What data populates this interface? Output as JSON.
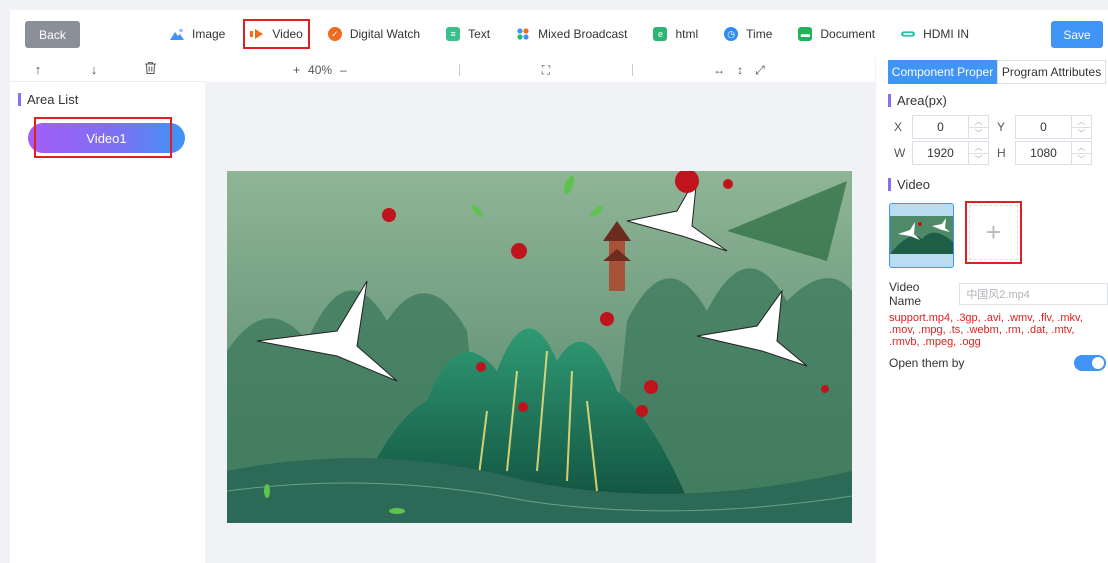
{
  "topbar": {
    "back_label": "Back",
    "save_label": "Save",
    "tools": [
      {
        "label": "Image",
        "icon": "image-icon",
        "highlighted": false
      },
      {
        "label": "Video",
        "icon": "video-icon",
        "highlighted": true
      },
      {
        "label": "Digital Watch",
        "icon": "watch-icon",
        "highlighted": false
      },
      {
        "label": "Text",
        "icon": "text-icon",
        "highlighted": false
      },
      {
        "label": "Mixed Broadcast",
        "icon": "mixed-icon",
        "highlighted": false
      },
      {
        "label": "html",
        "icon": "html-icon",
        "highlighted": false
      },
      {
        "label": "Time",
        "icon": "clock-icon",
        "highlighted": false
      },
      {
        "label": "Document",
        "icon": "document-icon",
        "highlighted": false
      },
      {
        "label": "HDMI IN",
        "icon": "hdmi-icon",
        "highlighted": false
      }
    ]
  },
  "left": {
    "toolbar": {
      "up": "↑",
      "down": "↓",
      "delete": "🗑"
    },
    "title": "Area List",
    "items": [
      {
        "label": "Video1",
        "selected": true
      }
    ]
  },
  "canvas": {
    "zoom_plus": "+",
    "zoom_level": "40%",
    "zoom_minus": "–",
    "fit_icon": "⛶",
    "horizontal_icon": "↔",
    "vertical_icon": "↕",
    "fullscreen_icon": "⤢"
  },
  "right": {
    "tabs": [
      {
        "label": "Component Proper",
        "active": true
      },
      {
        "label": "Program Attributes",
        "active": false
      }
    ],
    "area_title": "Area(px)",
    "x_label": "X",
    "x_value": "0",
    "y_label": "Y",
    "y_value": "0",
    "w_label": "W",
    "w_value": "1920",
    "h_label": "H",
    "h_value": "1080",
    "video_title": "Video",
    "video_name_label": "Video Name",
    "video_name_value": "中国风2.mp4",
    "support_text": "support.mp4, .3gp, .avi, .wmv, .flv, .mkv, .mov, .mpg, .ts, .webm, .rm, .dat, .mtv, .rmvb, .mpeg, .ogg",
    "open_label": "Open them by",
    "open_enabled": true
  },
  "colors": {
    "accent": "#3f94f5",
    "highlight_border": "#e02020",
    "section_bar": "#8b6cf4",
    "back_button": "#8a8f99"
  }
}
